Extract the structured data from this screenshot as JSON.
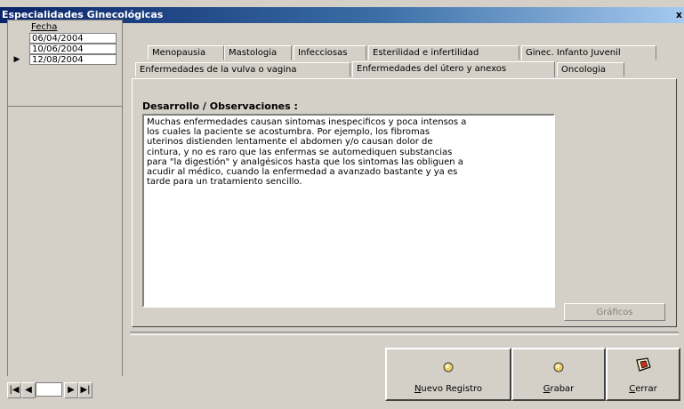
{
  "window": {
    "title": "Especialidades Ginecológicas",
    "close": "x"
  },
  "dates": {
    "header": "Fecha",
    "rows": [
      "06/04/2004",
      "10/06/2004",
      "12/08/2004"
    ],
    "selected_marker": "▶",
    "nav": {
      "first": "|◀",
      "prev": "◀",
      "next": "▶",
      "last": "▶|"
    }
  },
  "tabs": {
    "row1": [
      "Menopausia",
      "Mastologia",
      "Infecciosas",
      "Esterilidad e infertilidad",
      "Ginec. Infanto Juvenil"
    ],
    "row2": [
      "Enfermedades de la vulva o vagina",
      "Enfermedades del útero y anexos",
      "Oncologia"
    ]
  },
  "panel": {
    "label": "Desarrollo / Observaciones :",
    "text": "Muchas enfermedades causan sintomas inespecificos y poca intensos a\nlos cuales la paciente se acostumbra. Por ejemplo, los fibromas\nuterinos distienden lentamente el abdomen y/o causan dolor de\ncintura, y no es raro que las enfermas se automediquen substancias\npara \"la digestión\" y analgésicos hasta que los sintomas las obliguen a\nacudir al médico, cuando la enfermedad a avanzado bastante y ya es\ntarde para un tratamiento sencillo.",
    "graficos": "Gráficos"
  },
  "buttons": {
    "nuevo": {
      "mnemonic": "N",
      "rest": "uevo Registro"
    },
    "grabar": {
      "mnemonic": "G",
      "rest": "rabar"
    },
    "cerrar": {
      "mnemonic": "C",
      "rest": "errar"
    }
  }
}
